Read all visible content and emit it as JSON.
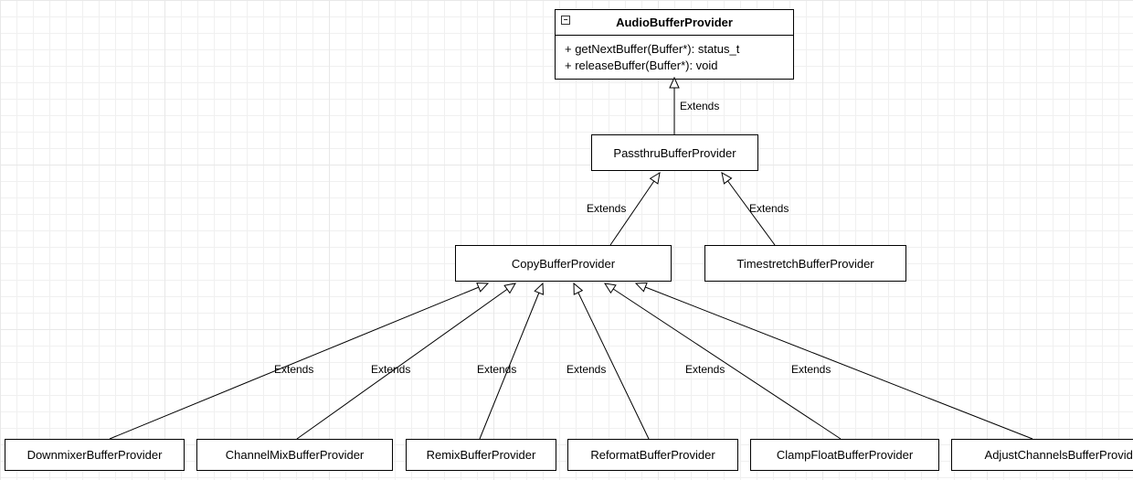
{
  "diagram": {
    "type": "uml-class-hierarchy",
    "root": {
      "name": "AudioBufferProvider",
      "methods": [
        "+ getNextBuffer(Buffer*): status_t",
        "+ releaseBuffer(Buffer*): void"
      ]
    },
    "edge_label": "Extends",
    "nodes": {
      "passthru": "PassthruBufferProvider",
      "copy": "CopyBufferProvider",
      "timestretch": "TimestretchBufferProvider",
      "downmixer": "DownmixerBufferProvider",
      "channelmix": "ChannelMixBufferProvider",
      "remix": "RemixBufferProvider",
      "reformat": "ReformatBufferProvider",
      "clampfloat": "ClampFloatBufferProvider",
      "adjustchannels": "AdjustChannelsBufferProvider"
    },
    "edges": [
      {
        "from": "passthru",
        "to": "root"
      },
      {
        "from": "copy",
        "to": "passthru"
      },
      {
        "from": "timestretch",
        "to": "passthru"
      },
      {
        "from": "downmixer",
        "to": "copy"
      },
      {
        "from": "channelmix",
        "to": "copy"
      },
      {
        "from": "remix",
        "to": "copy"
      },
      {
        "from": "reformat",
        "to": "copy"
      },
      {
        "from": "clampfloat",
        "to": "copy"
      },
      {
        "from": "adjustchannels",
        "to": "copy"
      }
    ]
  },
  "labels": {
    "e1": "Extends",
    "e2": "Extends",
    "e3": "Extends",
    "e4": "Extends",
    "e5": "Extends",
    "e6": "Extends",
    "e7": "Extends",
    "e8": "Extends",
    "e9": "Extends"
  }
}
